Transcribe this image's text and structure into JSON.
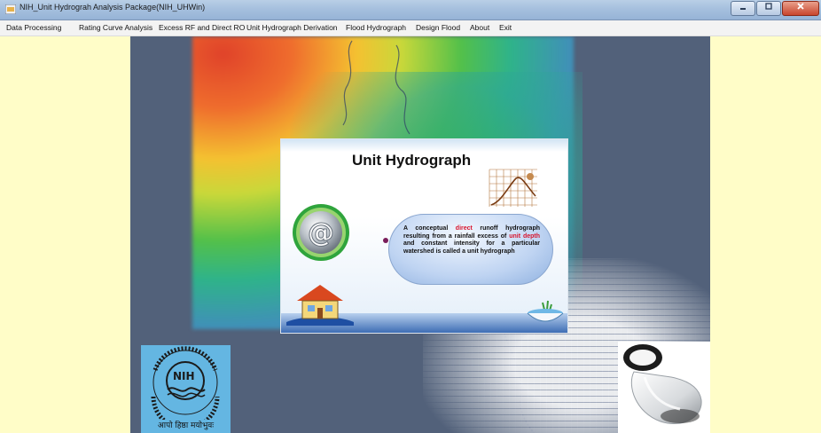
{
  "window": {
    "title": "NIH_Unit Hydrograh Analysis Package(NIH_UHWin)",
    "controls": [
      "minimize",
      "maximize",
      "close"
    ]
  },
  "menu": {
    "items": [
      "Data Processing",
      "Rating Curve Analysis",
      "Excess RF and Direct RO",
      "Unit Hydrograph Derivation",
      "Flood Hydrograph",
      "Design Flood",
      "About",
      "Exit"
    ]
  },
  "slide": {
    "title": "Unit Hydrograph",
    "definition": {
      "part1": "A conceptual ",
      "hl1": "direct",
      "part2": " runoff hydrograph resulting from a rainfall excess of ",
      "hl2": "unit depth",
      "part3": " and constant intensity for a particular watershed is called a unit hydrograph"
    }
  },
  "logo": {
    "initials": "NIH",
    "motto": "आपो हिष्ठा मयोभुवः"
  },
  "colors": {
    "background": "#fffdc8",
    "panel": "#52617a",
    "highlight": "#d8142d"
  },
  "icons": [
    "app-icon",
    "at-sign-icon",
    "house-icon",
    "hydrograph-sketch-icon",
    "bowl-icon",
    "lens-icon"
  ]
}
